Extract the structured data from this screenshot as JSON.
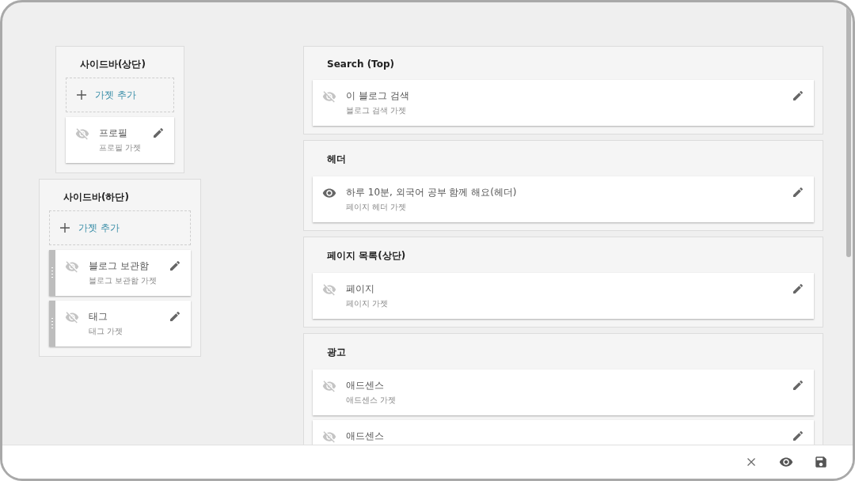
{
  "sidebar_panels": [
    {
      "title": "사이드바(상단)",
      "add_label": "가젯 추가",
      "widgets": [
        {
          "title": "프로필",
          "subtitle": "프로필 가젯",
          "visible": false,
          "handle": false
        }
      ]
    },
    {
      "title": "사이드바(하단)",
      "add_label": "가젯 추가",
      "widgets": [
        {
          "title": "블로그 보관함",
          "subtitle": "블로그 보관함 가젯",
          "visible": false,
          "handle": true
        },
        {
          "title": "태그",
          "subtitle": "태그 가젯",
          "visible": false,
          "handle": true
        }
      ]
    }
  ],
  "sections": [
    {
      "title": "Search (Top)",
      "widgets": [
        {
          "title": "이 블로그 검색",
          "subtitle": "블로그 검색 가젯",
          "visible": false
        }
      ]
    },
    {
      "title": "헤더",
      "widgets": [
        {
          "title": "하루 10분, 외국어 공부 함께 해요(헤더)",
          "subtitle": "페이지 헤더 가젯",
          "visible": true
        }
      ]
    },
    {
      "title": "페이지 목록(상단)",
      "widgets": [
        {
          "title": "페이지",
          "subtitle": "페이지 가젯",
          "visible": false
        }
      ]
    },
    {
      "title": "광고",
      "widgets": [
        {
          "title": "애드센스",
          "subtitle": "애드센스 가젯",
          "visible": false
        },
        {
          "title": "애드센스",
          "visible": false
        }
      ]
    }
  ],
  "footer": {
    "buttons": [
      {
        "kind": "close"
      },
      {
        "kind": "preview"
      },
      {
        "kind": "save"
      }
    ]
  }
}
